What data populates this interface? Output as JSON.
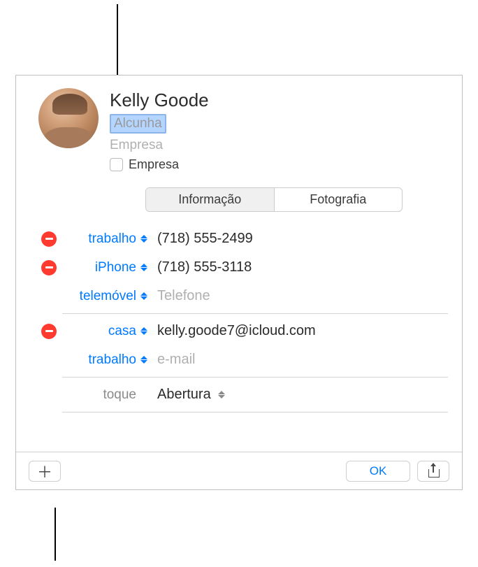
{
  "header": {
    "name": "Kelly  Goode",
    "nickname_placeholder": "Alcunha",
    "company_placeholder": "Empresa",
    "company_checkbox_label": "Empresa"
  },
  "tabs": {
    "info": "Informação",
    "photo": "Fotografia"
  },
  "phones": [
    {
      "label": "trabalho",
      "value": "(718) 555-2499",
      "deletable": true
    },
    {
      "label": "iPhone",
      "value": "(718) 555-3118",
      "deletable": true
    },
    {
      "label": "telemóvel",
      "value": "",
      "placeholder": "Telefone",
      "deletable": false
    }
  ],
  "emails": [
    {
      "label": "casa",
      "value": "kelly.goode7@icloud.com",
      "deletable": true
    },
    {
      "label": "trabalho",
      "value": "",
      "placeholder": "e-mail",
      "deletable": false
    }
  ],
  "ringtone": {
    "label": "toque",
    "value": "Abertura"
  },
  "footer": {
    "ok": "OK"
  }
}
